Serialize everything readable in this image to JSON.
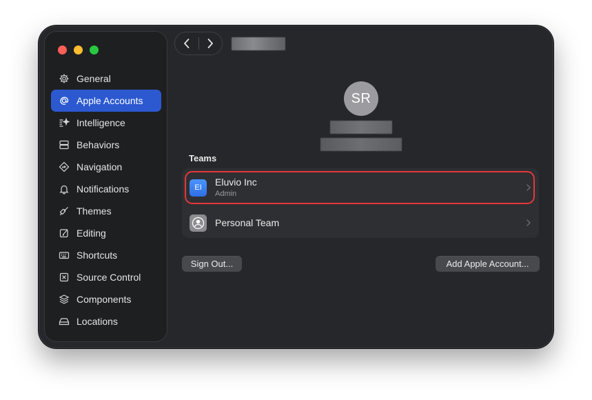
{
  "window": {
    "traffic_lights": [
      "close",
      "minimize",
      "zoom"
    ]
  },
  "sidebar": {
    "items": [
      {
        "label": "General",
        "icon": "gear-icon",
        "active": false
      },
      {
        "label": "Apple Accounts",
        "icon": "at-icon",
        "active": true
      },
      {
        "label": "Intelligence",
        "icon": "sparkle-icon",
        "active": false
      },
      {
        "label": "Behaviors",
        "icon": "behaviors-icon",
        "active": false
      },
      {
        "label": "Navigation",
        "icon": "navigation-icon",
        "active": false
      },
      {
        "label": "Notifications",
        "icon": "bell-icon",
        "active": false
      },
      {
        "label": "Themes",
        "icon": "brush-icon",
        "active": false
      },
      {
        "label": "Editing",
        "icon": "pencil-square-icon",
        "active": false
      },
      {
        "label": "Shortcuts",
        "icon": "keyboard-icon",
        "active": false
      },
      {
        "label": "Source Control",
        "icon": "source-control-icon",
        "active": false
      },
      {
        "label": "Components",
        "icon": "layers-icon",
        "active": false
      },
      {
        "label": "Locations",
        "icon": "drive-icon",
        "active": false
      }
    ],
    "active_color": "#2c59d0"
  },
  "toolbar": {
    "back_icon": "chevron-left-icon",
    "forward_icon": "chevron-right-icon"
  },
  "account": {
    "initials": "SR"
  },
  "teams": {
    "heading": "Teams",
    "rows": [
      {
        "initials": "EI",
        "name": "Eluvio Inc",
        "role": "Admin",
        "highlighted": true
      },
      {
        "name": "Personal Team",
        "icon": "person-icon",
        "highlighted": false
      }
    ]
  },
  "actions": {
    "sign_out": "Sign Out...",
    "add_account": "Add Apple Account..."
  },
  "colors": {
    "highlight": "#e5383b",
    "team_icon": "#3b82f6"
  }
}
